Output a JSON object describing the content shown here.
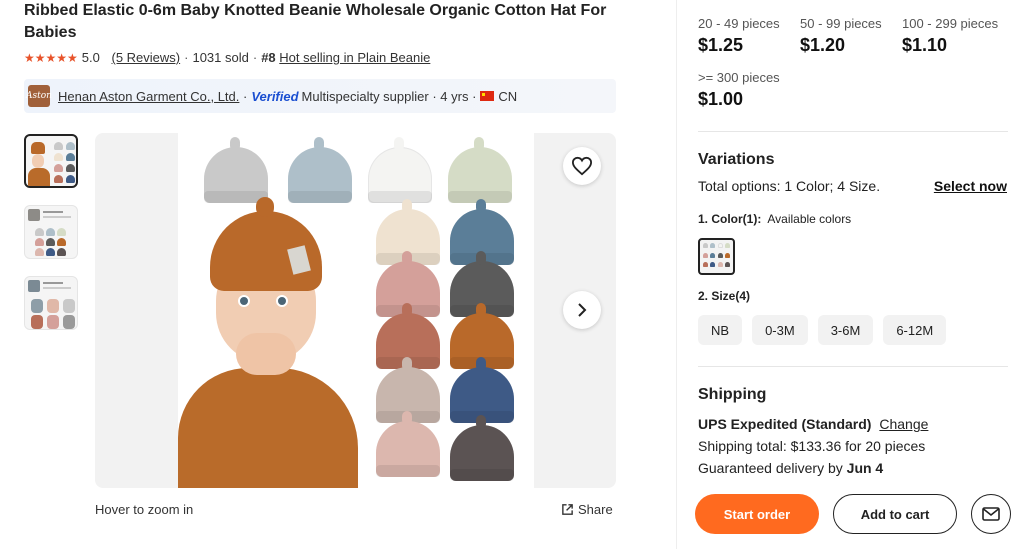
{
  "product": {
    "title": "Ribbed Elastic 0-6m Baby Knotted Beanie Wholesale Organic Cotton Hat For Babies",
    "rating": "5.0",
    "reviews_link": "(5 Reviews)",
    "sold": "1031 sold",
    "rank_prefix": "#8",
    "rank_link": "Hot selling in Plain Beanie",
    "stars": "★★★★★"
  },
  "supplier": {
    "logo_text": "Aston",
    "name": "Henan Aston Garment Co., Ltd.",
    "verified": "Verified",
    "type": "Multispecialty supplier",
    "years": "4 yrs",
    "country": "CN"
  },
  "gallery": {
    "zoom_hint": "Hover to zoom in",
    "share_label": "Share",
    "icons": {
      "favorite": "heart-icon",
      "next": "chevron-right-icon",
      "share": "share-icon"
    }
  },
  "pricing": {
    "tiers": [
      {
        "qty": "20 - 49 pieces",
        "price": "$1.25"
      },
      {
        "qty": "50 - 99 pieces",
        "price": "$1.20"
      },
      {
        "qty": "100 - 299 pieces",
        "price": "$1.10"
      },
      {
        "qty": ">= 300 pieces",
        "price": "$1.00"
      }
    ]
  },
  "variations": {
    "title": "Variations",
    "total": "Total options: 1 Color; 4 Size.",
    "select_now": "Select now",
    "color_label": "1. Color(1):",
    "color_note": "Available colors",
    "size_label": "2. Size(4)",
    "sizes": [
      "NB",
      "0-3M",
      "3-6M",
      "6-12M"
    ]
  },
  "shipping": {
    "title": "Shipping",
    "method": "UPS Expedited (Standard)",
    "change": "Change",
    "total": "Shipping total: $133.36 for 20 pieces",
    "delivery_prefix": "Guaranteed delivery by",
    "delivery_date": "Jun 4"
  },
  "actions": {
    "start_order": "Start order",
    "add_to_cart": "Add to cart",
    "message_icon": "mail-icon"
  },
  "colors": {
    "accent": "#ff6a1f",
    "star": "#e8532a",
    "verified": "#1b4fd1",
    "hat_palette": [
      "#c9c9c9",
      "#aebfc9",
      "#f4f4f2",
      "#d5dcc6",
      "#efe2d0",
      "#5b7e98",
      "#d4a09a",
      "#5b5b5b",
      "#b86f5a",
      "#b9692a",
      "#c8b6ad",
      "#3e5a86",
      "#dcb7ae",
      "#5b5353"
    ]
  }
}
